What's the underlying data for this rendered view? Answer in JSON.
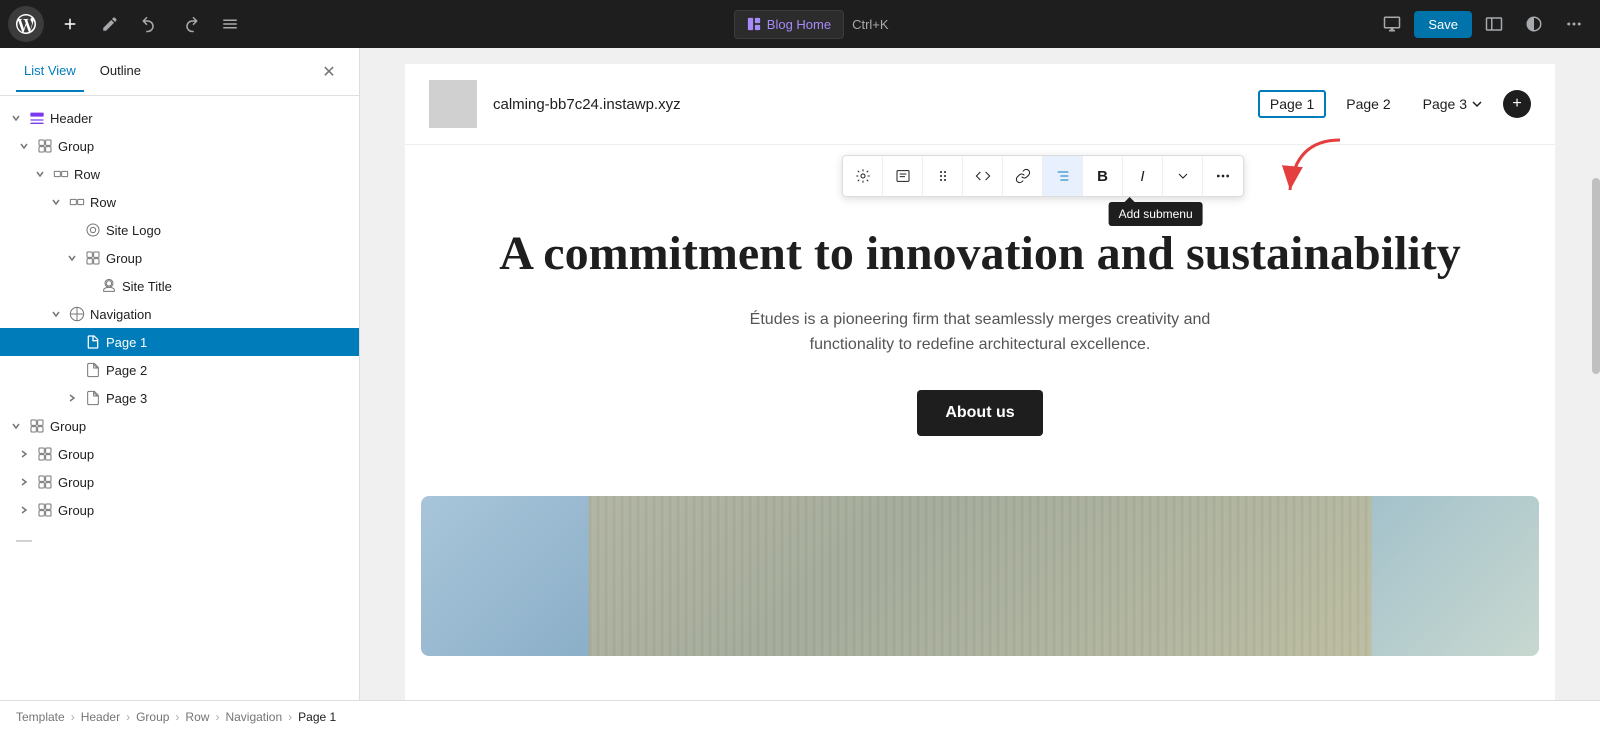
{
  "topbar": {
    "blog_home_label": "Blog Home",
    "shortcut": "Ctrl+K",
    "save_label": "Save"
  },
  "sidebar": {
    "tab_list_view": "List View",
    "tab_outline": "Outline",
    "items": [
      {
        "id": "header",
        "label": "Header",
        "indent": 0,
        "type": "header-icon",
        "chevron": "down",
        "selected": false
      },
      {
        "id": "group-1",
        "label": "Group",
        "indent": 1,
        "type": "group-icon",
        "chevron": "down",
        "selected": false
      },
      {
        "id": "row-1",
        "label": "Row",
        "indent": 2,
        "type": "row-icon",
        "chevron": "down",
        "selected": false
      },
      {
        "id": "row-2",
        "label": "Row",
        "indent": 3,
        "type": "row-icon",
        "chevron": "down",
        "selected": false
      },
      {
        "id": "site-logo",
        "label": "Site Logo",
        "indent": 4,
        "type": "logo-icon",
        "chevron": "",
        "selected": false
      },
      {
        "id": "group-2",
        "label": "Group",
        "indent": 4,
        "type": "group-icon",
        "chevron": "down",
        "selected": false
      },
      {
        "id": "site-title",
        "label": "Site Title",
        "indent": 5,
        "type": "pin-icon",
        "chevron": "",
        "selected": false
      },
      {
        "id": "navigation",
        "label": "Navigation",
        "indent": 3,
        "type": "circle-icon",
        "chevron": "down",
        "selected": false
      },
      {
        "id": "page-1",
        "label": "Page 1",
        "indent": 4,
        "type": "page-icon",
        "chevron": "",
        "selected": true
      },
      {
        "id": "page-2",
        "label": "Page 2",
        "indent": 4,
        "type": "page-icon",
        "chevron": "",
        "selected": false
      },
      {
        "id": "page-3",
        "label": "Page 3",
        "indent": 4,
        "type": "page-icon",
        "chevron": "right",
        "selected": false
      },
      {
        "id": "group-3",
        "label": "Group",
        "indent": 0,
        "type": "group-icon",
        "chevron": "down",
        "selected": false
      },
      {
        "id": "group-4",
        "label": "Group",
        "indent": 1,
        "type": "group-icon",
        "chevron": "right",
        "selected": false
      },
      {
        "id": "group-5",
        "label": "Group",
        "indent": 1,
        "type": "group-icon",
        "chevron": "right",
        "selected": false
      },
      {
        "id": "group-6",
        "label": "Group",
        "indent": 1,
        "type": "group-icon",
        "chevron": "right",
        "selected": false
      }
    ]
  },
  "canvas": {
    "site_domain": "calming-bb7c24.instawp.xyz",
    "nav_pages": [
      "Page 1",
      "Page 2",
      "Page 3"
    ],
    "hero_title": "A commitment to innovation and sustainability",
    "hero_subtitle": "Études is a pioneering firm that seamlessly merges creativity and functionality to redefine architectural excellence.",
    "hero_cta": "About us",
    "toolbar": {
      "tooltip": "Add submenu"
    }
  },
  "breadcrumb": {
    "items": [
      "Template",
      "Header",
      "Group",
      "Row",
      "Navigation",
      "Page 1"
    ]
  }
}
